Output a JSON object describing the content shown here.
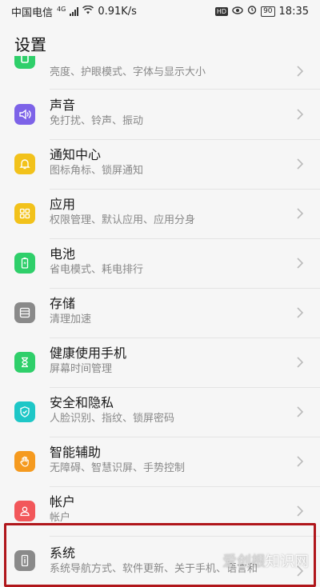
{
  "status_bar": {
    "carrier": "中国电信",
    "network": "4G",
    "speed": "0.91K/s",
    "battery": "90",
    "time": "18:35"
  },
  "header": {
    "title": "设置"
  },
  "items": [
    {
      "title": "",
      "subtitle": "亮度、护眼模式、字体与显示大小",
      "icon": "display-icon",
      "color": "#2fcf6a"
    },
    {
      "title": "声音",
      "subtitle": "免打扰、铃声、振动",
      "icon": "speaker-icon",
      "color": "#7d63e8"
    },
    {
      "title": "通知中心",
      "subtitle": "图标角标、锁屏通知",
      "icon": "bell-icon",
      "color": "#f2c21b"
    },
    {
      "title": "应用",
      "subtitle": "权限管理、默认应用、应用分身",
      "icon": "grid-icon",
      "color": "#f2c21b"
    },
    {
      "title": "电池",
      "subtitle": "省电模式、耗电排行",
      "icon": "battery-icon",
      "color": "#2fcf6a"
    },
    {
      "title": "存储",
      "subtitle": "清理加速",
      "icon": "storage-icon",
      "color": "#8a8a8a"
    },
    {
      "title": "健康使用手机",
      "subtitle": "屏幕时间管理",
      "icon": "hourglass-icon",
      "color": "#2fcf6a"
    },
    {
      "title": "安全和隐私",
      "subtitle": "人脸识别、指纹、锁屏密码",
      "icon": "shield-icon",
      "color": "#1ec7c7"
    },
    {
      "title": "智能辅助",
      "subtitle": "无障碍、智慧识屏、手势控制",
      "icon": "hand-icon",
      "color": "#f59a1f"
    },
    {
      "title": "帐户",
      "subtitle": "帐户",
      "icon": "user-icon",
      "color": "#f2575a"
    },
    {
      "title": "系统",
      "subtitle": "系统导航方式、软件更新、关于手机、语言和",
      "icon": "phone-info-icon",
      "color": "#8a8a8a"
    }
  ],
  "watermark": {
    "part1": "爱创根",
    "part2": "知识网"
  }
}
